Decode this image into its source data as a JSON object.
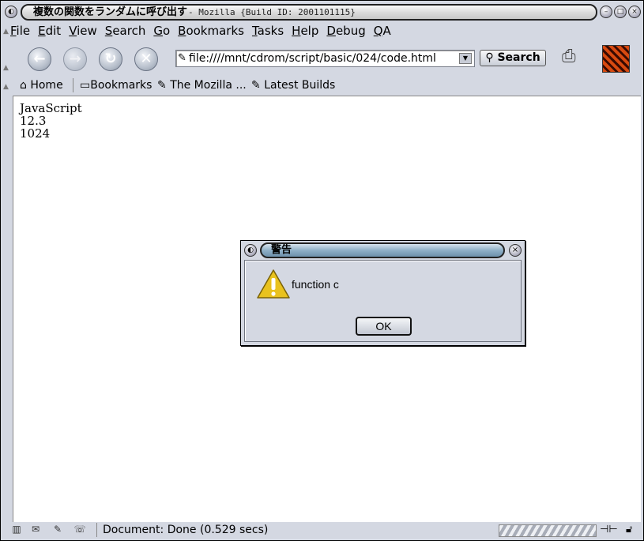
{
  "window": {
    "title": "複数の関数をランダムに呼び出す",
    "title_suffix": "- Mozilla {Build ID: 2001101115}"
  },
  "menu": [
    "File",
    "Edit",
    "View",
    "Search",
    "Go",
    "Bookmarks",
    "Tasks",
    "Help",
    "Debug",
    "QA"
  ],
  "toolbar": {
    "url": "file:////mnt/cdrom/script/basic/024/code.html",
    "search_label": "Search"
  },
  "personal_toolbar": {
    "home": "Home",
    "bookmarks": "Bookmarks",
    "mozilla": "The Mozilla ...",
    "latest": "Latest Builds"
  },
  "content": {
    "lines": [
      "JavaScript",
      "12.3",
      "1024"
    ]
  },
  "dialog": {
    "title": "警告",
    "message": "function c",
    "ok_label": "OK"
  },
  "status": {
    "text": "Document: Done (0.529 secs)"
  },
  "icons": {
    "back": "back-icon",
    "forward": "forward-icon",
    "reload": "reload-icon",
    "stop": "stop-icon",
    "warning": "warning-icon",
    "print": "print-icon",
    "lock": "lock-icon"
  }
}
